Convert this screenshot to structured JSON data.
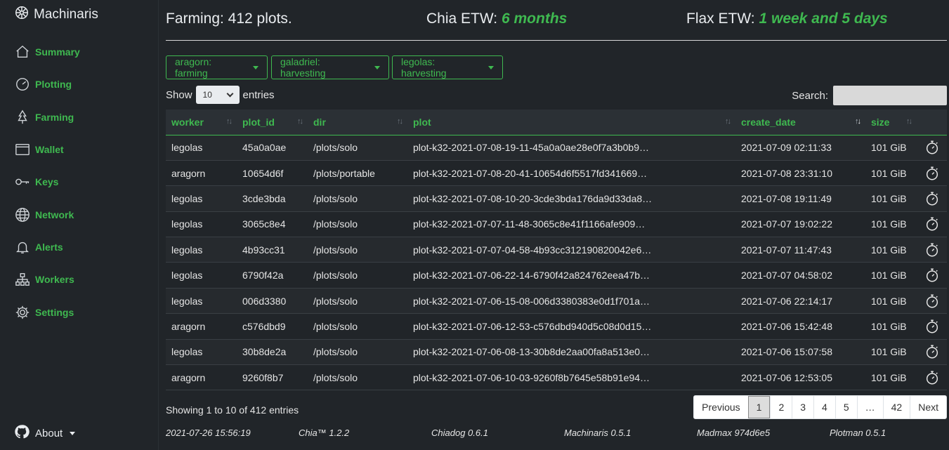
{
  "app": {
    "title": "Machinaris"
  },
  "sidebar": {
    "items": [
      {
        "label": "Summary",
        "icon": "home-icon"
      },
      {
        "label": "Plotting",
        "icon": "speedometer-icon"
      },
      {
        "label": "Farming",
        "icon": "tree-icon"
      },
      {
        "label": "Wallet",
        "icon": "wallet-icon"
      },
      {
        "label": "Keys",
        "icon": "key-icon"
      },
      {
        "label": "Network",
        "icon": "globe-icon"
      },
      {
        "label": "Alerts",
        "icon": "bell-icon"
      },
      {
        "label": "Workers",
        "icon": "diagram-icon"
      },
      {
        "label": "Settings",
        "icon": "gear-icon"
      }
    ],
    "about_label": "About"
  },
  "summary": {
    "farming_text": "Farming: 412 plots.",
    "chia_label": "Chia ETW:",
    "chia_value": "6 months",
    "flax_label": "Flax ETW:",
    "flax_value": "1 week and 5 days"
  },
  "workers": [
    {
      "label": "aragorn: farming"
    },
    {
      "label": "galadriel: harvesting"
    },
    {
      "label": "legolas: harvesting"
    }
  ],
  "table_controls": {
    "show_label": "Show",
    "entries_value": "10",
    "entries_label": "entries",
    "search_label": "Search:",
    "search_value": ""
  },
  "table": {
    "columns": [
      "worker",
      "plot_id",
      "dir",
      "plot",
      "create_date",
      "size",
      ""
    ],
    "rows": [
      [
        "legolas",
        "45a0a0ae",
        "/plots/solo",
        "plot-k32-2021-07-08-19-11-45a0a0ae28e0f7a3b0b9…",
        "2021-07-09 02:11:33",
        "101 GiB"
      ],
      [
        "aragorn",
        "10654d6f",
        "/plots/portable",
        "plot-k32-2021-07-08-20-41-10654d6f5517fd341669…",
        "2021-07-08 23:31:10",
        "101 GiB"
      ],
      [
        "legolas",
        "3cde3bda",
        "/plots/solo",
        "plot-k32-2021-07-08-10-20-3cde3bda176da9d33da8…",
        "2021-07-08 19:11:49",
        "101 GiB"
      ],
      [
        "legolas",
        "3065c8e4",
        "/plots/solo",
        "plot-k32-2021-07-07-11-48-3065c8e41f1166afe909…",
        "2021-07-07 19:02:22",
        "101 GiB"
      ],
      [
        "legolas",
        "4b93cc31",
        "/plots/solo",
        "plot-k32-2021-07-07-04-58-4b93cc312190820042e6…",
        "2021-07-07 11:47:43",
        "101 GiB"
      ],
      [
        "legolas",
        "6790f42a",
        "/plots/solo",
        "plot-k32-2021-07-06-22-14-6790f42a824762eea47b…",
        "2021-07-07 04:58:02",
        "101 GiB"
      ],
      [
        "legolas",
        "006d3380",
        "/plots/solo",
        "plot-k32-2021-07-06-15-08-006d3380383e0d1f701a…",
        "2021-07-06 22:14:17",
        "101 GiB"
      ],
      [
        "aragorn",
        "c576dbd9",
        "/plots/solo",
        "plot-k32-2021-07-06-12-53-c576dbd940d5c08d0d15…",
        "2021-07-06 15:42:48",
        "101 GiB"
      ],
      [
        "legolas",
        "30b8de2a",
        "/plots/solo",
        "plot-k32-2021-07-06-08-13-30b8de2aa00fa8a513e0…",
        "2021-07-06 15:07:58",
        "101 GiB"
      ],
      [
        "aragorn",
        "9260f8b7",
        "/plots/solo",
        "plot-k32-2021-07-06-10-03-9260f8b7645e58b91e94…",
        "2021-07-06 12:53:05",
        "101 GiB"
      ]
    ]
  },
  "pagination": {
    "info": "Showing 1 to 10 of 412 entries",
    "items": [
      "Previous",
      "1",
      "2",
      "3",
      "4",
      "5",
      "…",
      "42",
      "Next"
    ],
    "active": "1"
  },
  "footer": {
    "items": [
      "2021-07-26 15:56:19",
      "Chia™ 1.2.2",
      "Chiadog 0.6.1",
      "Machinaris 0.5.1",
      "Madmax 974d6e5",
      "Plotman 0.5.1"
    ]
  },
  "colors": {
    "accent": "#3fb950",
    "background": "#212529"
  }
}
